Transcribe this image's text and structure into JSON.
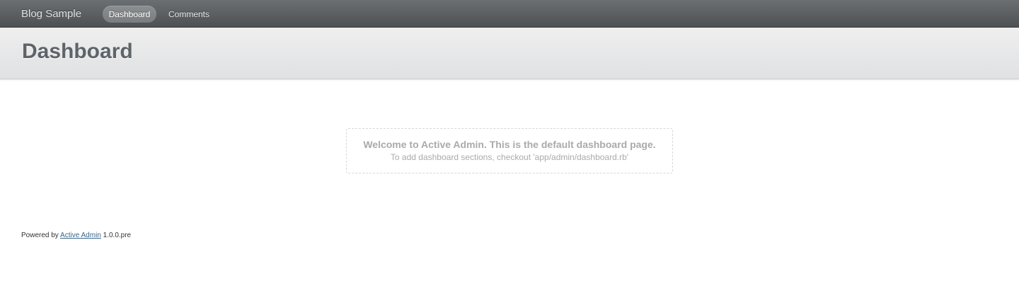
{
  "header": {
    "site_title": "Blog Sample",
    "tabs": [
      {
        "label": "Dashboard",
        "current": true
      },
      {
        "label": "Comments",
        "current": false
      }
    ]
  },
  "title_bar": {
    "page_title": "Dashboard"
  },
  "main": {
    "blank_slate_heading": "Welcome to Active Admin. This is the default dashboard page.",
    "blank_slate_sub": "To add dashboard sections, checkout 'app/admin/dashboard.rb'"
  },
  "footer": {
    "prefix": "Powered by",
    "link_label": "Active Admin",
    "version": "1.0.0.pre"
  },
  "colors": {
    "header_bg": "#5e6266",
    "title_text": "#5e6469",
    "muted_text": "#aaaaaa",
    "link": "#38678b"
  }
}
